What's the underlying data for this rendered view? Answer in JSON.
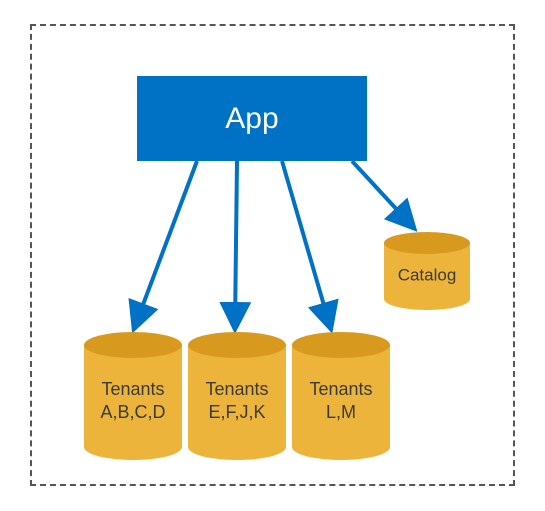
{
  "app": {
    "label": "App"
  },
  "catalog": {
    "label": "Catalog"
  },
  "databases": [
    {
      "line1": "Tenants",
      "line2": "A,B,C,D"
    },
    {
      "line1": "Tenants",
      "line2": "E,F,J,K"
    },
    {
      "line1": "Tenants",
      "line2": "L,M"
    }
  ],
  "colors": {
    "app": "#0072C6",
    "db_fill": "#EDB43B",
    "db_dark": "#D8991F",
    "arrow": "#0072C6",
    "border": "#555"
  }
}
